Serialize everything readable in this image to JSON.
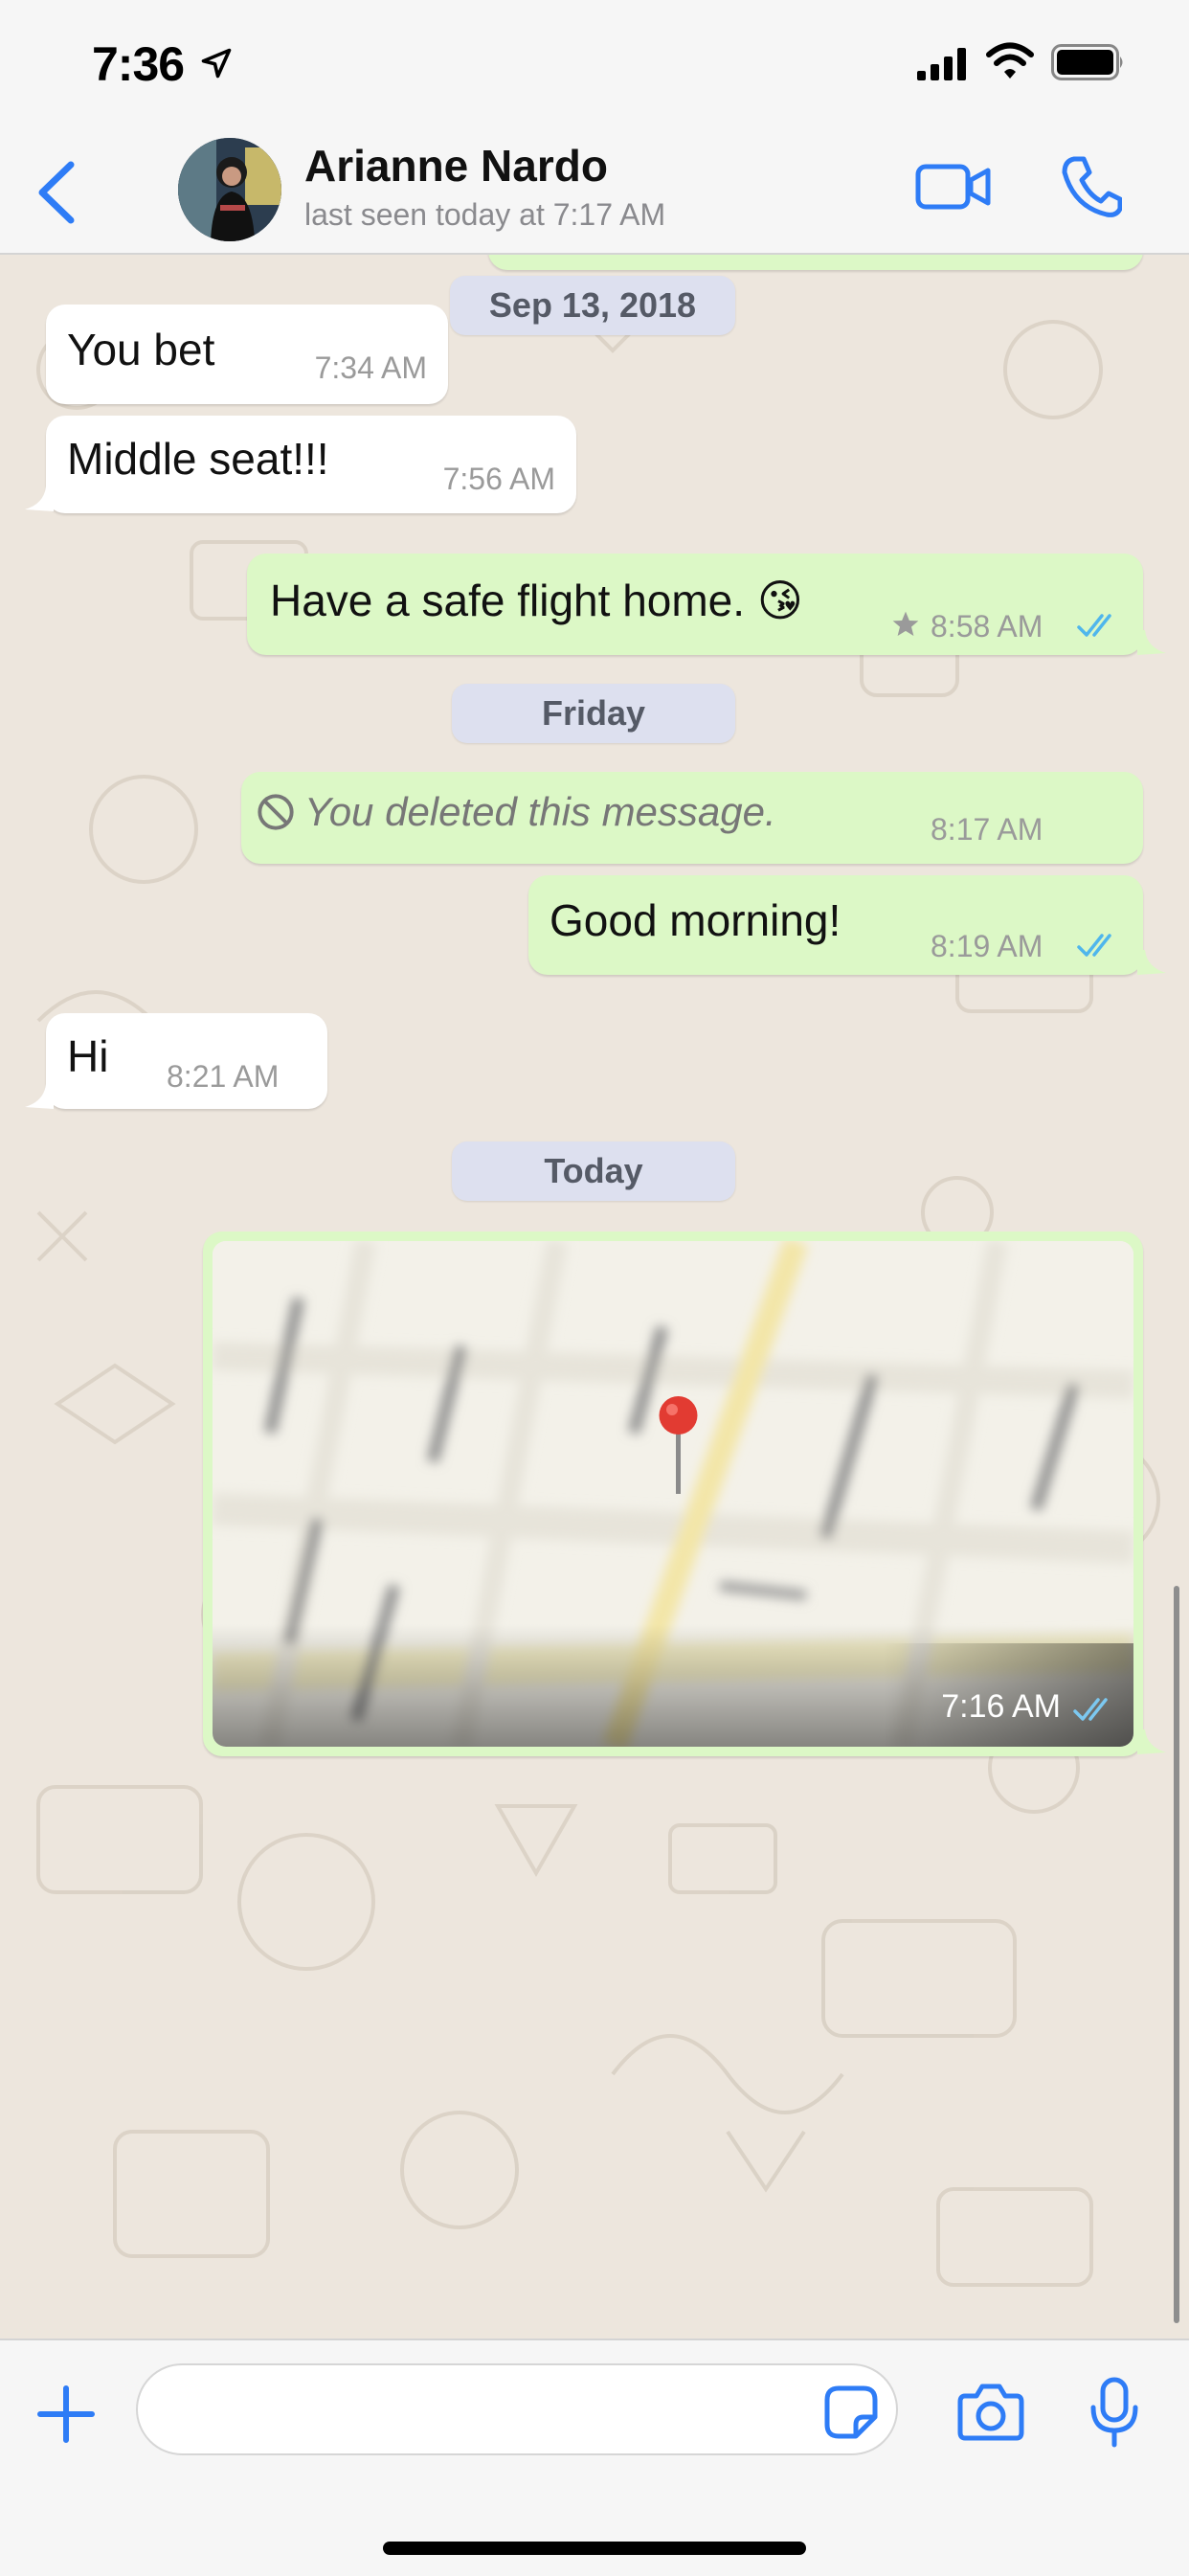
{
  "status_bar": {
    "time": "7:36",
    "icons": [
      "location-arrow-icon",
      "cellular-signal-icon",
      "wifi-icon",
      "battery-icon"
    ]
  },
  "header": {
    "back_icon": "chevron-left-icon",
    "contact_name": "Arianne Nardo",
    "last_seen": "last seen today at 7:17 AM",
    "video_icon": "video-camera-icon",
    "call_icon": "phone-icon"
  },
  "colors": {
    "accent": "#2e7cf6",
    "incoming_bubble": "#ffffff",
    "outgoing_bubble": "#dcf8c6",
    "chat_background": "#ede6dd",
    "read_ticks": "#4fb6ec"
  },
  "messages": [
    {
      "type": "date",
      "label": "Sep 13, 2018"
    },
    {
      "type": "incoming",
      "text": "You bet",
      "time": "7:34 AM"
    },
    {
      "type": "incoming",
      "text": "Middle seat!!!",
      "time": "7:56 AM"
    },
    {
      "type": "outgoing",
      "text": "Have a safe flight home. 😘",
      "time": "8:58 AM",
      "starred": true,
      "status": "read"
    },
    {
      "type": "date",
      "label": "Friday"
    },
    {
      "type": "outgoing-deleted",
      "text": "You deleted this message.",
      "time": "8:17 AM"
    },
    {
      "type": "outgoing",
      "text": "Good morning!",
      "time": "8:19 AM",
      "status": "read"
    },
    {
      "type": "incoming",
      "text": "Hi",
      "time": "8:21 AM"
    },
    {
      "type": "date",
      "label": "Today"
    },
    {
      "type": "outgoing-location",
      "time": "7:16 AM",
      "status": "read",
      "icon": "map-pin-icon"
    }
  ],
  "input_bar": {
    "placeholder": "",
    "icons": [
      "plus-icon",
      "sticker-icon",
      "camera-icon",
      "microphone-icon"
    ]
  }
}
